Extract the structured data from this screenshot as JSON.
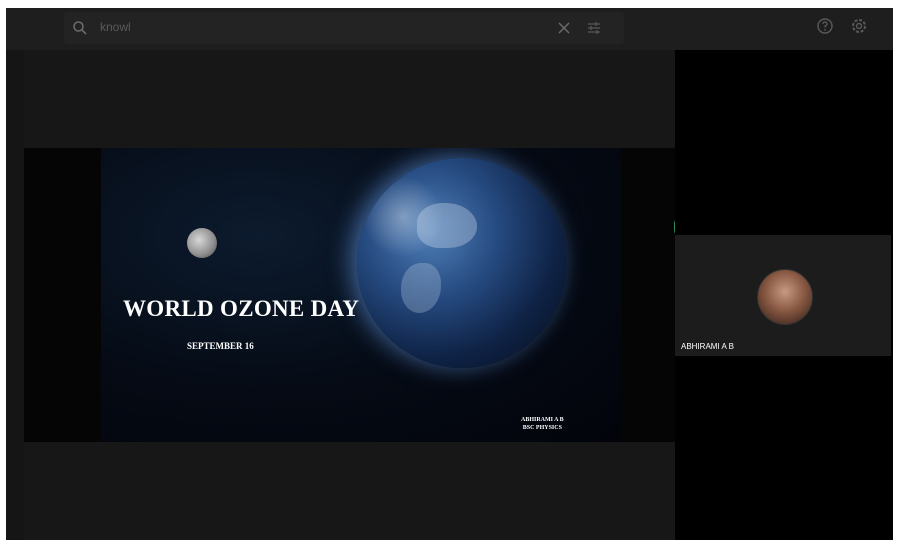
{
  "search": {
    "value": "knowl"
  },
  "slide": {
    "title": "WORLD OZONE DAY",
    "subtitle": "SEPTEMBER 16",
    "credit_name": "ABHIRAMI A B",
    "credit_course": "BSC PHYSICS"
  },
  "participant": {
    "name": "ABHIRAMI A B"
  },
  "icons": [
    "search-icon",
    "close-icon",
    "tune-icon",
    "help-icon",
    "settings-icon"
  ]
}
